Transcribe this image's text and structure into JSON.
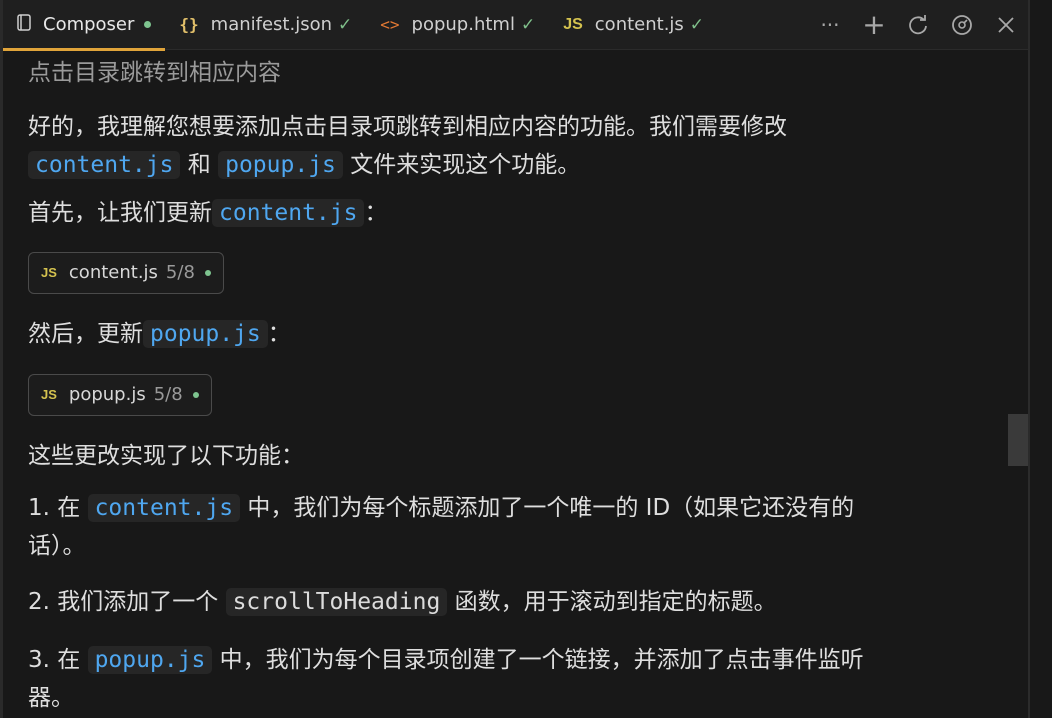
{
  "tabs": [
    {
      "label": "Composer",
      "icon": "book-icon",
      "active": true,
      "modified": true
    },
    {
      "label": "manifest.json",
      "icon": "json-braces-icon",
      "status": "✓"
    },
    {
      "label": "popup.html",
      "icon": "html-code-icon",
      "status": "✓"
    },
    {
      "label": "content.js",
      "icon": "js-file-icon",
      "icon_text": "JS",
      "status": "✓"
    }
  ],
  "actions": {
    "more": "···",
    "add": "+"
  },
  "content": {
    "prompt": "点击目录跳转到相应内容",
    "intro_1": "好的，我理解您想要添加点击目录项跳转到相应内容的功能。我们需要修改",
    "intro_code1": "content.js",
    "intro_and": "和",
    "intro_code2": "popup.js",
    "intro_2": "文件来实现这个功能。",
    "first_text": "首先，让我们更新",
    "first_code": "content.js",
    "first_colon": "：",
    "chip1": {
      "icon_text": "JS",
      "name": "content.js",
      "progress": "5/8"
    },
    "then_text": "然后，更新",
    "then_code": "popup.js",
    "then_colon": "：",
    "chip2": {
      "icon_text": "JS",
      "name": "popup.js",
      "progress": "5/8"
    },
    "summary": "这些更改实现了以下功能：",
    "item1_a": "1. 在",
    "item1_code": "content.js",
    "item1_b": "中，我们为每个标题添加了一个唯一的 ID（如果它还没有的",
    "item1_c": "话）。",
    "item2_a": "2. 我们添加了一个",
    "item2_code": "scrollToHeading",
    "item2_b": "函数，用于滚动到指定的标题。",
    "item3_a": "3. 在",
    "item3_code": "popup.js",
    "item3_b": "中，我们为每个目录项创建了一个链接，并添加了点击事件监听",
    "item3_c": "器。"
  },
  "colors": {
    "accent_tab": "#e0a43a",
    "code_blue": "#4fa7f0",
    "status_green": "#7ec48f"
  }
}
